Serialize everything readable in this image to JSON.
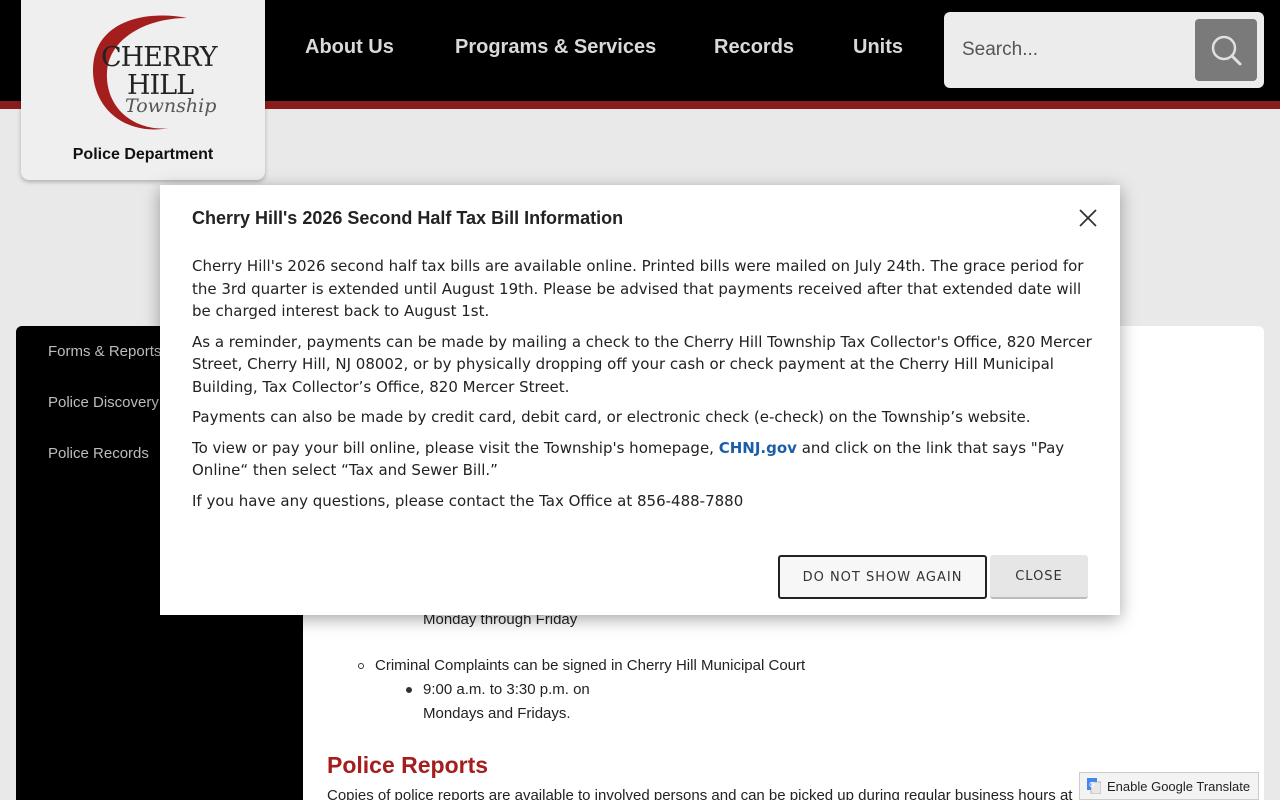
{
  "header": {
    "logo": {
      "line1": "CHERRY",
      "line2": "HILL",
      "line3": "Township",
      "dept": "Police Department"
    },
    "nav": [
      "About Us",
      "Programs & Services",
      "Records",
      "Units"
    ],
    "search": {
      "placeholder": "Search..."
    }
  },
  "sidebar": {
    "items": [
      "Forms & Reports",
      "Police Discovery",
      "Police Records"
    ]
  },
  "content": {
    "visible_lines": {
      "hours_days": "Monday through Friday",
      "complaints": "Criminal Complaints can be signed in Cherry Hill Municipal Court",
      "complaint_time": "9:00 a.m. to 3:30 p.m. on",
      "complaint_days": "Mondays and Fridays."
    },
    "reports_heading": "Police Reports",
    "reports_text": "Copies of police reports are available to involved persons and can be picked up during regular business hours at"
  },
  "modal": {
    "title": "Cherry Hill's 2026 Second Half Tax Bill Information",
    "p1": "Cherry Hill's 2026 second half tax bills are available online. Printed bills were mailed on July 24th.  The grace period for the 3rd quarter is extended until August 19th. Please be advised that payments received after that extended date will be charged interest back to August 1st.",
    "p2": "As a reminder, payments can be made by mailing a check to the Cherry Hill Township Tax Collector's Office, 820 Mercer Street, Cherry Hill, NJ 08002, or by physically dropping off your cash or check payment at the Cherry Hill Municipal Building, Tax Collector’s Office, 820 Mercer Street.",
    "p3": "Payments can also be made by credit card, debit card, or electronic check (e-check) on the Township’s website.",
    "p4_before": "To view or pay your bill online, please visit the Township's homepage, ",
    "p4_link": "CHNJ.gov",
    "p4_after": " and click on the link that says \"Pay Online“ then select “Tax and Sewer Bill.”",
    "p5": "If you have any questions, please contact the Tax Office at 856-488-7880",
    "btn_dont_show": "DO NOT SHOW AGAIN",
    "btn_close": "CLOSE"
  },
  "translate": {
    "label": "Enable Google Translate"
  },
  "colors": {
    "header_bg": "#000000",
    "stripe": "#8a1c1c",
    "link": "#1a5fa8",
    "heading_red": "#a51e1e"
  }
}
